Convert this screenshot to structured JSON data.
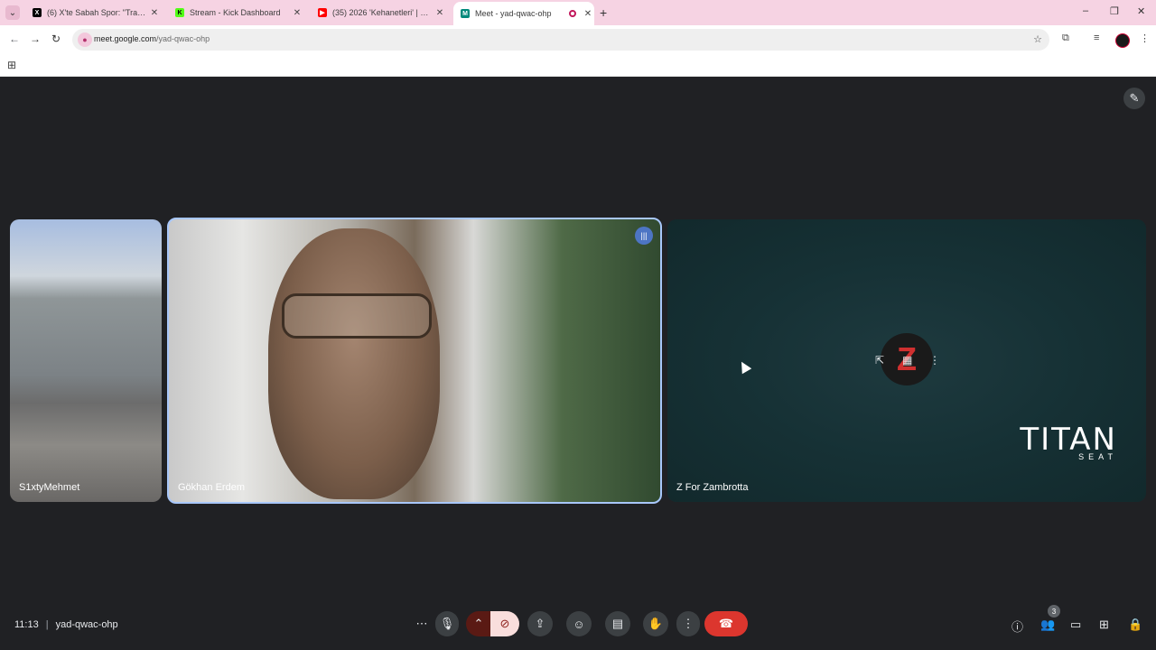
{
  "browser": {
    "tabs": [
      {
        "title": "(6) X'te Sabah Spor: \"Trabzonsp",
        "favicon": "X",
        "color": "#000000"
      },
      {
        "title": "Stream - Kick Dashboard",
        "favicon": "K",
        "color": "#53fc18"
      },
      {
        "title": "(35) 2026 'Kehanetleri' | Erdem A",
        "favicon": "▶",
        "color": "#ff0000"
      },
      {
        "title": "Meet - yad-qwac-ohp",
        "favicon": "M",
        "color": "#00897b"
      }
    ],
    "close_glyph": "✕",
    "new_tab_glyph": "+",
    "url_host": "meet.google.com",
    "url_path": "/yad-qwac-ohp"
  },
  "meet": {
    "participants": [
      {
        "name": "S1xtyMehmet"
      },
      {
        "name": "Gökhan Erdem"
      },
      {
        "name": "Z For Zambrotta"
      }
    ],
    "logo_text": "TITAN",
    "logo_sub": "SEAT",
    "time": "11:13",
    "meeting_code": "yad-qwac-ohp",
    "people_count": "3"
  }
}
